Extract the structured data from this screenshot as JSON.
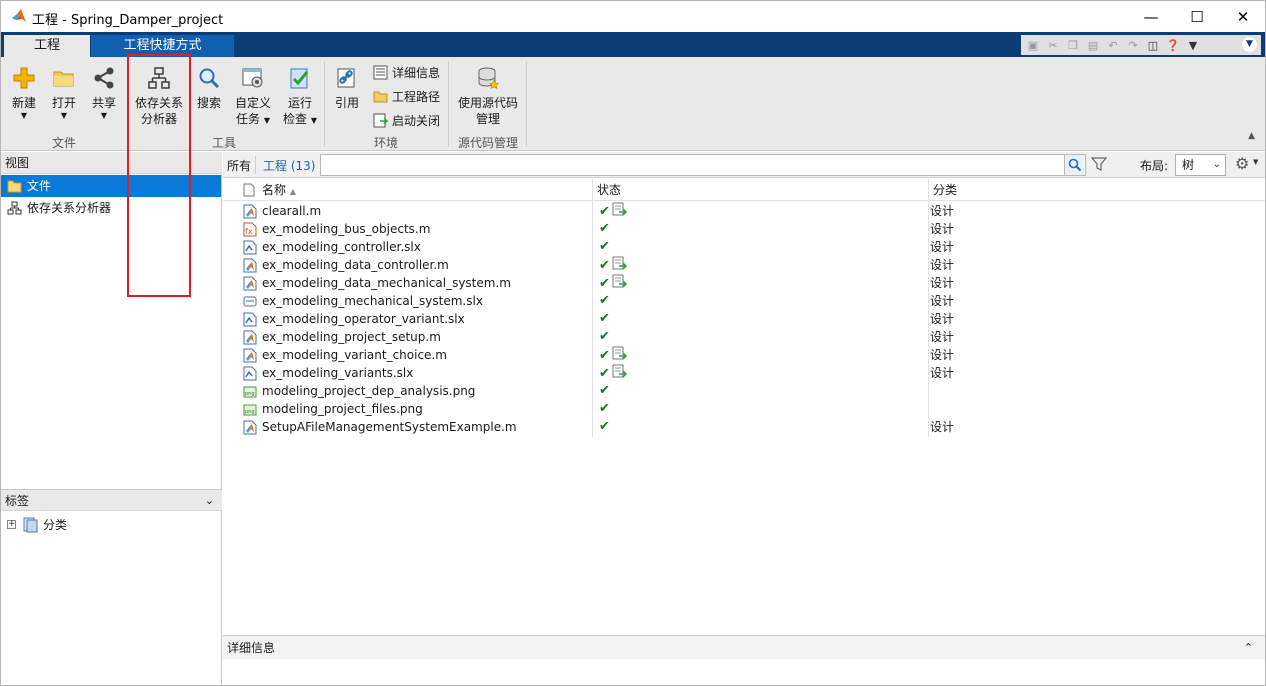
{
  "window": {
    "title": "工程 - Spring_Damper_project"
  },
  "ribbon_tabs": {
    "project": "工程",
    "shortcuts": "工程快捷方式"
  },
  "ribbon": {
    "file_group": {
      "label": "文件",
      "new": "新建",
      "open": "打开",
      "share": "共享"
    },
    "tools_group": {
      "label": "工具",
      "dep_analyzer_line1": "依存关系",
      "dep_analyzer_line2": "分析器",
      "search": "搜索",
      "custom_line1": "自定义",
      "custom_line2": "任务",
      "run_line1": "运行",
      "run_line2": "检查"
    },
    "env_group": {
      "label": "环境",
      "reference": "引用",
      "details": "详细信息",
      "project_path": "工程路径",
      "startup_shutdown": "启动关闭"
    },
    "source_group": {
      "label": "源代码管理",
      "use_source_line1": "使用源代码",
      "use_source_line2": "管理"
    }
  },
  "views": {
    "header": "视图",
    "items": [
      "文件",
      "依存关系分析器"
    ]
  },
  "labels_pane": {
    "header": "标签",
    "items": [
      "分类"
    ]
  },
  "filter": {
    "all": "所有",
    "project_count": "工程 (13)",
    "search_value": "",
    "layout_label": "布局:",
    "layout_value": "树"
  },
  "columns": {
    "name": "名称",
    "status": "状态",
    "classification": "分类"
  },
  "files": [
    {
      "name": "clearall.m",
      "type": "m",
      "status_extra": true,
      "classification": "设计"
    },
    {
      "name": "ex_modeling_bus_objects.m",
      "type": "mfx",
      "status_extra": false,
      "classification": "设计"
    },
    {
      "name": "ex_modeling_controller.slx",
      "type": "slx",
      "status_extra": false,
      "classification": "设计"
    },
    {
      "name": "ex_modeling_data_controller.m",
      "type": "m",
      "status_extra": true,
      "classification": "设计"
    },
    {
      "name": "ex_modeling_data_mechanical_system.m",
      "type": "m",
      "status_extra": true,
      "classification": "设计"
    },
    {
      "name": "ex_modeling_mechanical_system.slx",
      "type": "slxb",
      "status_extra": false,
      "classification": "设计"
    },
    {
      "name": "ex_modeling_operator_variant.slx",
      "type": "slx",
      "status_extra": false,
      "classification": "设计"
    },
    {
      "name": "ex_modeling_project_setup.m",
      "type": "m",
      "status_extra": false,
      "classification": "设计"
    },
    {
      "name": "ex_modeling_variant_choice.m",
      "type": "m",
      "status_extra": true,
      "classification": "设计"
    },
    {
      "name": "ex_modeling_variants.slx",
      "type": "slx",
      "status_extra": true,
      "classification": "设计"
    },
    {
      "name": "modeling_project_dep_analysis.png",
      "type": "png",
      "status_extra": false,
      "classification": ""
    },
    {
      "name": "modeling_project_files.png",
      "type": "png",
      "status_extra": false,
      "classification": ""
    },
    {
      "name": "SetupAFileManagementSystemExample.m",
      "type": "m",
      "status_extra": false,
      "classification": "设计"
    }
  ],
  "details_bar": {
    "label": "详细信息"
  },
  "colors": {
    "tab_strip": "#0b3d76",
    "selected": "#0a7ad9",
    "check": "#0f7a1f",
    "highlight": "#e02020"
  }
}
